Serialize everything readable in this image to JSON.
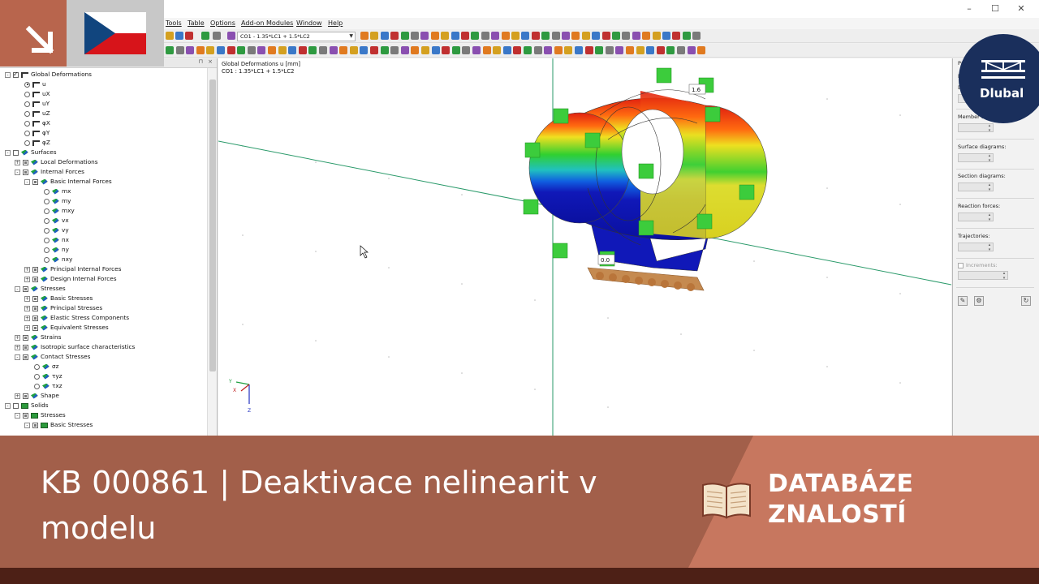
{
  "menu": [
    "Tools",
    "Table",
    "Options",
    "Add-on Modules",
    "Window",
    "Help"
  ],
  "loadcase_combo": "CO1 - 1.35*LC1 + 1.5*LC2",
  "window_controls": [
    "–",
    "☐",
    "✕"
  ],
  "navigator": {
    "pin": "⊓",
    "close": "×",
    "items": [
      {
        "label": "Global Deformations",
        "ind": 0,
        "exp": "-",
        "cb": "on",
        "icon": "line"
      },
      {
        "label": "u",
        "ind": 2,
        "rad": "on",
        "icon": "line"
      },
      {
        "label": "uX",
        "ind": 2,
        "rad": "off",
        "icon": "line"
      },
      {
        "label": "uY",
        "ind": 2,
        "rad": "off",
        "icon": "line"
      },
      {
        "label": "uZ",
        "ind": 2,
        "rad": "off",
        "icon": "line"
      },
      {
        "label": "φX",
        "ind": 2,
        "rad": "off",
        "icon": "line"
      },
      {
        "label": "φY",
        "ind": 2,
        "rad": "off",
        "icon": "line"
      },
      {
        "label": "φZ",
        "ind": 2,
        "rad": "off",
        "icon": "line"
      },
      {
        "label": "Surfaces",
        "ind": 0,
        "exp": "-",
        "cb": "off",
        "icon": "surf"
      },
      {
        "label": "Local Deformations",
        "ind": 1,
        "exp": "+",
        "cb": "part",
        "icon": "surf"
      },
      {
        "label": "Internal Forces",
        "ind": 1,
        "exp": "-",
        "cb": "part",
        "icon": "surf"
      },
      {
        "label": "Basic Internal Forces",
        "ind": 2,
        "exp": "-",
        "cb": "part",
        "icon": "surf"
      },
      {
        "label": "mx",
        "ind": 4,
        "rad": "off",
        "icon": "surf"
      },
      {
        "label": "my",
        "ind": 4,
        "rad": "off",
        "icon": "surf"
      },
      {
        "label": "mxy",
        "ind": 4,
        "rad": "off",
        "icon": "surf"
      },
      {
        "label": "vx",
        "ind": 4,
        "rad": "off",
        "icon": "surf"
      },
      {
        "label": "vy",
        "ind": 4,
        "rad": "off",
        "icon": "surf"
      },
      {
        "label": "nx",
        "ind": 4,
        "rad": "off",
        "icon": "surf"
      },
      {
        "label": "ny",
        "ind": 4,
        "rad": "off",
        "icon": "surf"
      },
      {
        "label": "nxy",
        "ind": 4,
        "rad": "off",
        "icon": "surf"
      },
      {
        "label": "Principal Internal Forces",
        "ind": 2,
        "exp": "+",
        "cb": "part",
        "icon": "surf"
      },
      {
        "label": "Design Internal Forces",
        "ind": 2,
        "exp": "+",
        "cb": "part",
        "icon": "surf"
      },
      {
        "label": "Stresses",
        "ind": 1,
        "exp": "-",
        "cb": "part",
        "icon": "surf"
      },
      {
        "label": "Basic Stresses",
        "ind": 2,
        "exp": "+",
        "cb": "part",
        "icon": "surf"
      },
      {
        "label": "Principal Stresses",
        "ind": 2,
        "exp": "+",
        "cb": "part",
        "icon": "surf"
      },
      {
        "label": "Elastic Stress Components",
        "ind": 2,
        "exp": "+",
        "cb": "part",
        "icon": "surf"
      },
      {
        "label": "Equivalent Stresses",
        "ind": 2,
        "exp": "+",
        "cb": "part",
        "icon": "surf"
      },
      {
        "label": "Strains",
        "ind": 1,
        "exp": "+",
        "cb": "part",
        "icon": "surf"
      },
      {
        "label": "Isotropic surface characteristics",
        "ind": 1,
        "exp": "+",
        "cb": "part",
        "icon": "surf"
      },
      {
        "label": "Contact Stresses",
        "ind": 1,
        "exp": "-",
        "cb": "part",
        "icon": "surf"
      },
      {
        "label": "σz",
        "ind": 3,
        "rad": "off",
        "icon": "surf"
      },
      {
        "label": "τyz",
        "ind": 3,
        "rad": "off",
        "icon": "surf"
      },
      {
        "label": "τxz",
        "ind": 3,
        "rad": "off",
        "icon": "surf"
      },
      {
        "label": "Shape",
        "ind": 1,
        "exp": "+",
        "cb": "part",
        "icon": "surf"
      },
      {
        "label": "Solids",
        "ind": 0,
        "exp": "-",
        "cb": "off",
        "icon": "solid"
      },
      {
        "label": "Stresses",
        "ind": 1,
        "exp": "-",
        "cb": "part",
        "icon": "solid"
      },
      {
        "label": "Basic Stresses",
        "ind": 2,
        "exp": "-",
        "cb": "part",
        "icon": "solid"
      }
    ]
  },
  "viewport": {
    "info_line1": "Global Deformations u [mm]",
    "info_line2": "CO1 : 1.35*LC1 + 1.5*LC2",
    "value_top": "1.6",
    "value_bottom": "0.0",
    "axis_x": "X",
    "axis_y": "Y",
    "axis_z": "Z"
  },
  "right_panel": {
    "title": "Pa",
    "labels": [
      "D",
      "D",
      "Member d",
      "Surface diagrams:",
      "Section diagrams:",
      "Reaction forces:",
      "Trajectories:",
      "Increments:"
    ]
  },
  "logo": "Dlubal",
  "banner": {
    "title": "KB 000861 | Deaktivace nelinearit v modelu",
    "tag_line1": "DATABÁZE",
    "tag_line2": "ZNALOSTÍ"
  },
  "colors": {
    "banner_dark": "#a25f4a",
    "banner_light": "#c7775f",
    "logo_bg": "#1a2f5c",
    "footer": "#4d2016"
  }
}
